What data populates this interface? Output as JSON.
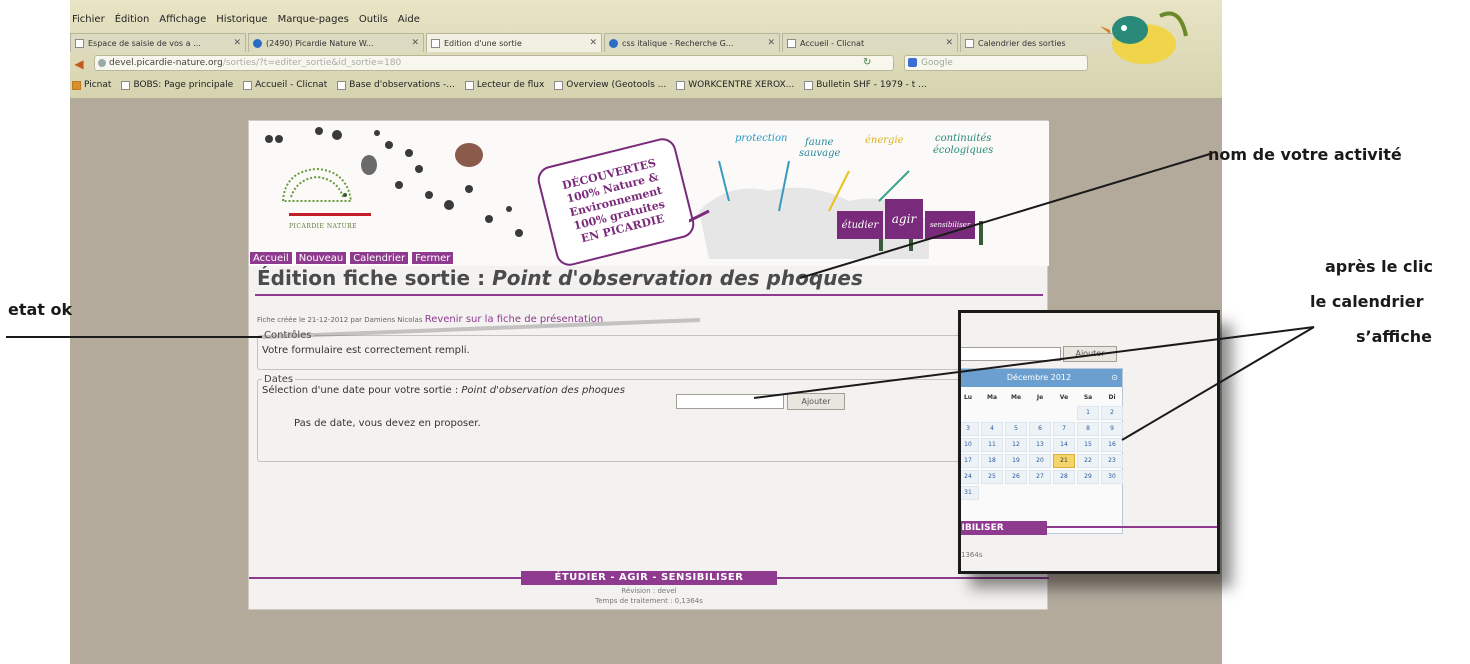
{
  "browser": {
    "menu": [
      "Fichier",
      "Édition",
      "Affichage",
      "Historique",
      "Marque-pages",
      "Outils",
      "Aide"
    ],
    "tabs": [
      {
        "label": "Espace de saisie de vos a ...",
        "icon": "page-icon"
      },
      {
        "label": "(2490) Picardie Nature W...",
        "icon": "globe-icon"
      },
      {
        "label": "Edition d'une sortie",
        "icon": "page-icon"
      },
      {
        "label": "css italique - Recherche G...",
        "icon": "search-icon"
      },
      {
        "label": "Accueil - Clicnat",
        "icon": "page-icon"
      },
      {
        "label": "Calendrier des sorties",
        "icon": "page-icon"
      }
    ],
    "url_host": "devel.picardie-nature.org",
    "url_path": "/sorties/?t=editer_sortie&id_sortie=180",
    "search_placeholder": "Google",
    "bookmarks": [
      "Picnat",
      "BOBS: Page principale",
      "Accueil - Clicnat",
      "Base d'observations -...",
      "Lecteur de flux",
      "Overview (Geotools ...",
      "WORKCENTRE XEROX...",
      "Bulletin SHF - 1979 - t ..."
    ]
  },
  "banner": {
    "logo_text": "PICARDIE NATURE",
    "stamp_lines": [
      "DÉCOUVERTES",
      "100% Nature &",
      "Environnement",
      "100% gratuites",
      "EN PICARDIE"
    ],
    "tags": {
      "protection": "protection",
      "faune1": "faune",
      "faune2": "sauvage",
      "energie": "énergie",
      "cont1": "continuités",
      "cont2": "écologiques"
    },
    "boxes": {
      "etudier": "étudier",
      "agir": "agir",
      "sensibiliser": "sensibiliser"
    }
  },
  "nav": {
    "accueil": "Accueil",
    "nouveau": "Nouveau",
    "calendrier": "Calendrier",
    "fermer": "Fermer"
  },
  "page": {
    "title_prefix": "Édition fiche sortie : ",
    "title_name": "Point d'observation des phoques",
    "meta": "Fiche créée le 21-12-2012 par Damiens Nicolas",
    "meta_link": "Revenir sur la fiche de présentation",
    "controls_legend": "Contrôles",
    "controls_text": "Votre formulaire est correctement rempli.",
    "dates_legend": "Dates",
    "dates_label": "Sélection d'une date pour votre sortie : ",
    "dates_label_name": "Point d'observation des phoques",
    "add_button": "Ajouter",
    "no_date": "Pas de date, vous devez en proposer.",
    "footer_tag": "ÉTUDIER - AGIR - SENSIBILISER",
    "footer_revision": "Révision : devel",
    "footer_time": "Temps de traitement : 0,1364s"
  },
  "calendar": {
    "month": "Décembre 2012",
    "next_icon": "⊙",
    "dows": [
      "Lu",
      "Ma",
      "Me",
      "Je",
      "Ve",
      "Sa",
      "Di"
    ],
    "days": [
      "",
      "",
      "",
      "",
      "",
      "1",
      "2",
      "3",
      "4",
      "5",
      "6",
      "7",
      "8",
      "9",
      "10",
      "11",
      "12",
      "13",
      "14",
      "15",
      "16",
      "17",
      "18",
      "19",
      "20",
      "21",
      "22",
      "23",
      "24",
      "25",
      "26",
      "27",
      "28",
      "29",
      "30",
      "31"
    ],
    "today": "21",
    "inset_tag": "SIBILISER",
    "inset_time": "1364s"
  },
  "annotations": {
    "activity": "nom de votre activité",
    "state": "etat ok",
    "cal1": "après le clic",
    "cal2": "le calendrier",
    "cal3": "s’affiche"
  }
}
